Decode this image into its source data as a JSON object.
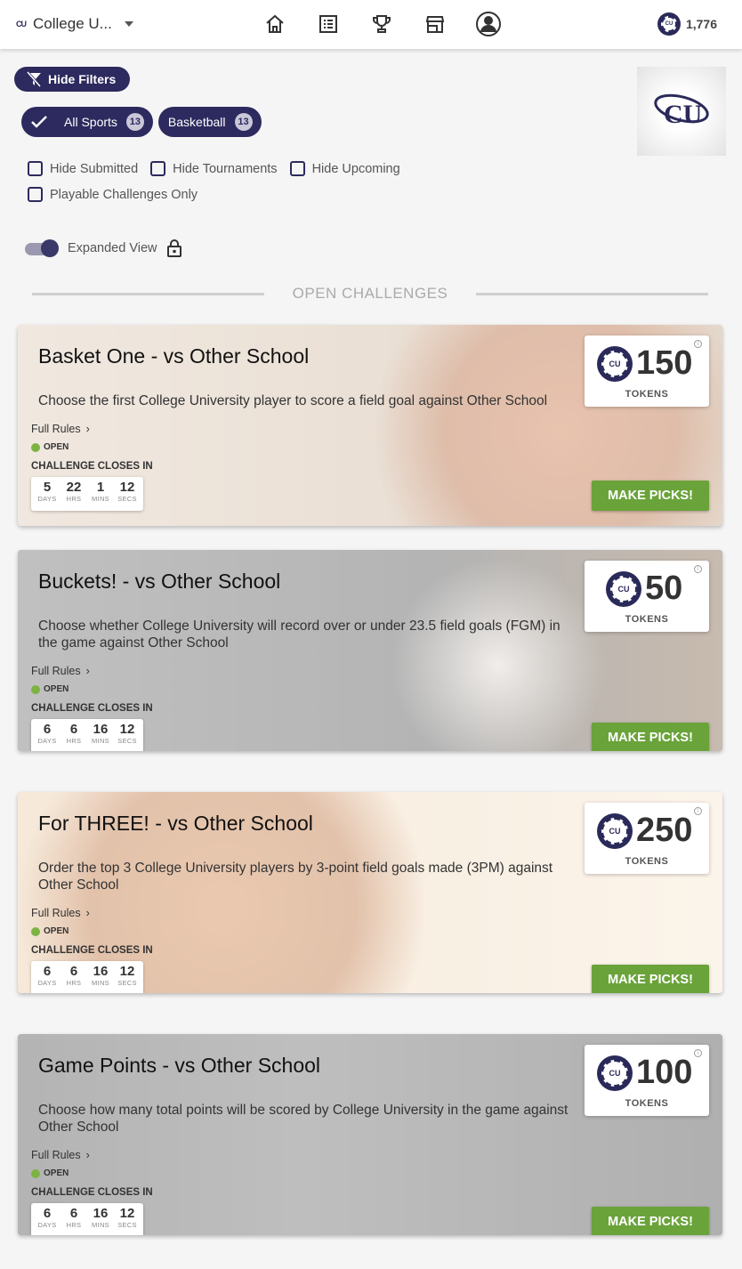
{
  "header": {
    "org_logo_text": "CU",
    "org_name": "College U...",
    "balance": "1,776"
  },
  "filters": {
    "hide_filters_label": "Hide Filters",
    "chips": [
      {
        "label": "All Sports",
        "count": "13"
      },
      {
        "label": "Basketball",
        "count": "13"
      }
    ],
    "checkboxes": [
      {
        "label": "Hide Submitted",
        "checked": false
      },
      {
        "label": "Hide Tournaments",
        "checked": false
      },
      {
        "label": "Hide Upcoming",
        "checked": false
      },
      {
        "label": "Playable Challenges Only",
        "checked": false
      }
    ],
    "expanded_view_label": "Expanded View",
    "expanded_view_on": true
  },
  "school_logo_text": "CU",
  "section_title": "OPEN CHALLENGES",
  "labels": {
    "full_rules": "Full Rules",
    "status_open": "OPEN",
    "closes_in": "CHALLENGE CLOSES IN",
    "tokens": "TOKENS",
    "make_picks": "MAKE PICKS!",
    "days": "DAYS",
    "hrs": "HRS",
    "mins": "MINS",
    "secs": "SECS",
    "coin": "CU",
    "info": "i"
  },
  "challenges": [
    {
      "title": "Basket One - vs Other School",
      "description": "Choose the first College University player to score a field goal against Other School",
      "tokens": "150",
      "timer": {
        "days": "5",
        "hrs": "22",
        "mins": "1",
        "secs": "12"
      }
    },
    {
      "title": "Buckets! - vs Other School",
      "description": "Choose whether College University will record over or under 23.5 field goals (FGM) in the game against Other School",
      "tokens": "50",
      "timer": {
        "days": "6",
        "hrs": "6",
        "mins": "16",
        "secs": "12"
      }
    },
    {
      "title": "For THREE! - vs Other School",
      "description": "Order the top 3 College University players by 3-point field goals made (3PM) against Other School",
      "tokens": "250",
      "timer": {
        "days": "6",
        "hrs": "6",
        "mins": "16",
        "secs": "12"
      }
    },
    {
      "title": "Game Points - vs Other School",
      "description": "Choose how many total points will be scored by College University in the game against Other School",
      "tokens": "100",
      "timer": {
        "days": "6",
        "hrs": "6",
        "mins": "16",
        "secs": "12"
      }
    }
  ]
}
